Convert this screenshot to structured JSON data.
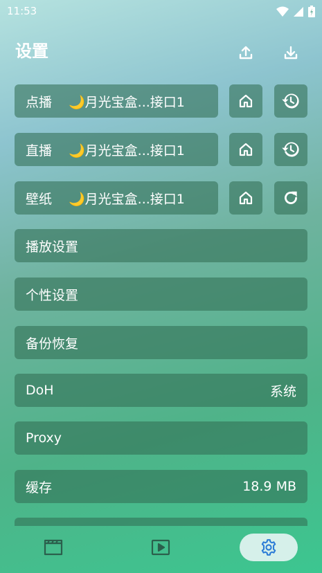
{
  "status_bar": {
    "time": "11:53"
  },
  "header": {
    "title": "设置"
  },
  "sources": [
    {
      "label": "点播",
      "source": "🌙月光宝盒...接口1",
      "secondary_icon": "history-icon"
    },
    {
      "label": "直播",
      "source": "🌙月光宝盒...接口1",
      "secondary_icon": "history-icon"
    },
    {
      "label": "壁纸",
      "source": "🌙月光宝盒...接口1",
      "secondary_icon": "refresh-icon"
    }
  ],
  "menu": [
    {
      "label": "播放设置",
      "value": ""
    },
    {
      "label": "个性设置",
      "value": ""
    },
    {
      "label": "备份恢复",
      "value": ""
    },
    {
      "label": "DoH",
      "value": "系统"
    },
    {
      "label": "Proxy",
      "value": ""
    },
    {
      "label": "缓存",
      "value": "18.9 MB"
    }
  ],
  "nav": {
    "active": "settings"
  },
  "colors": {
    "accent": "#2b7bd6",
    "row_bg": "rgba(50,110,85,0.58)",
    "nav_active_bg": "#d6f0ea"
  }
}
